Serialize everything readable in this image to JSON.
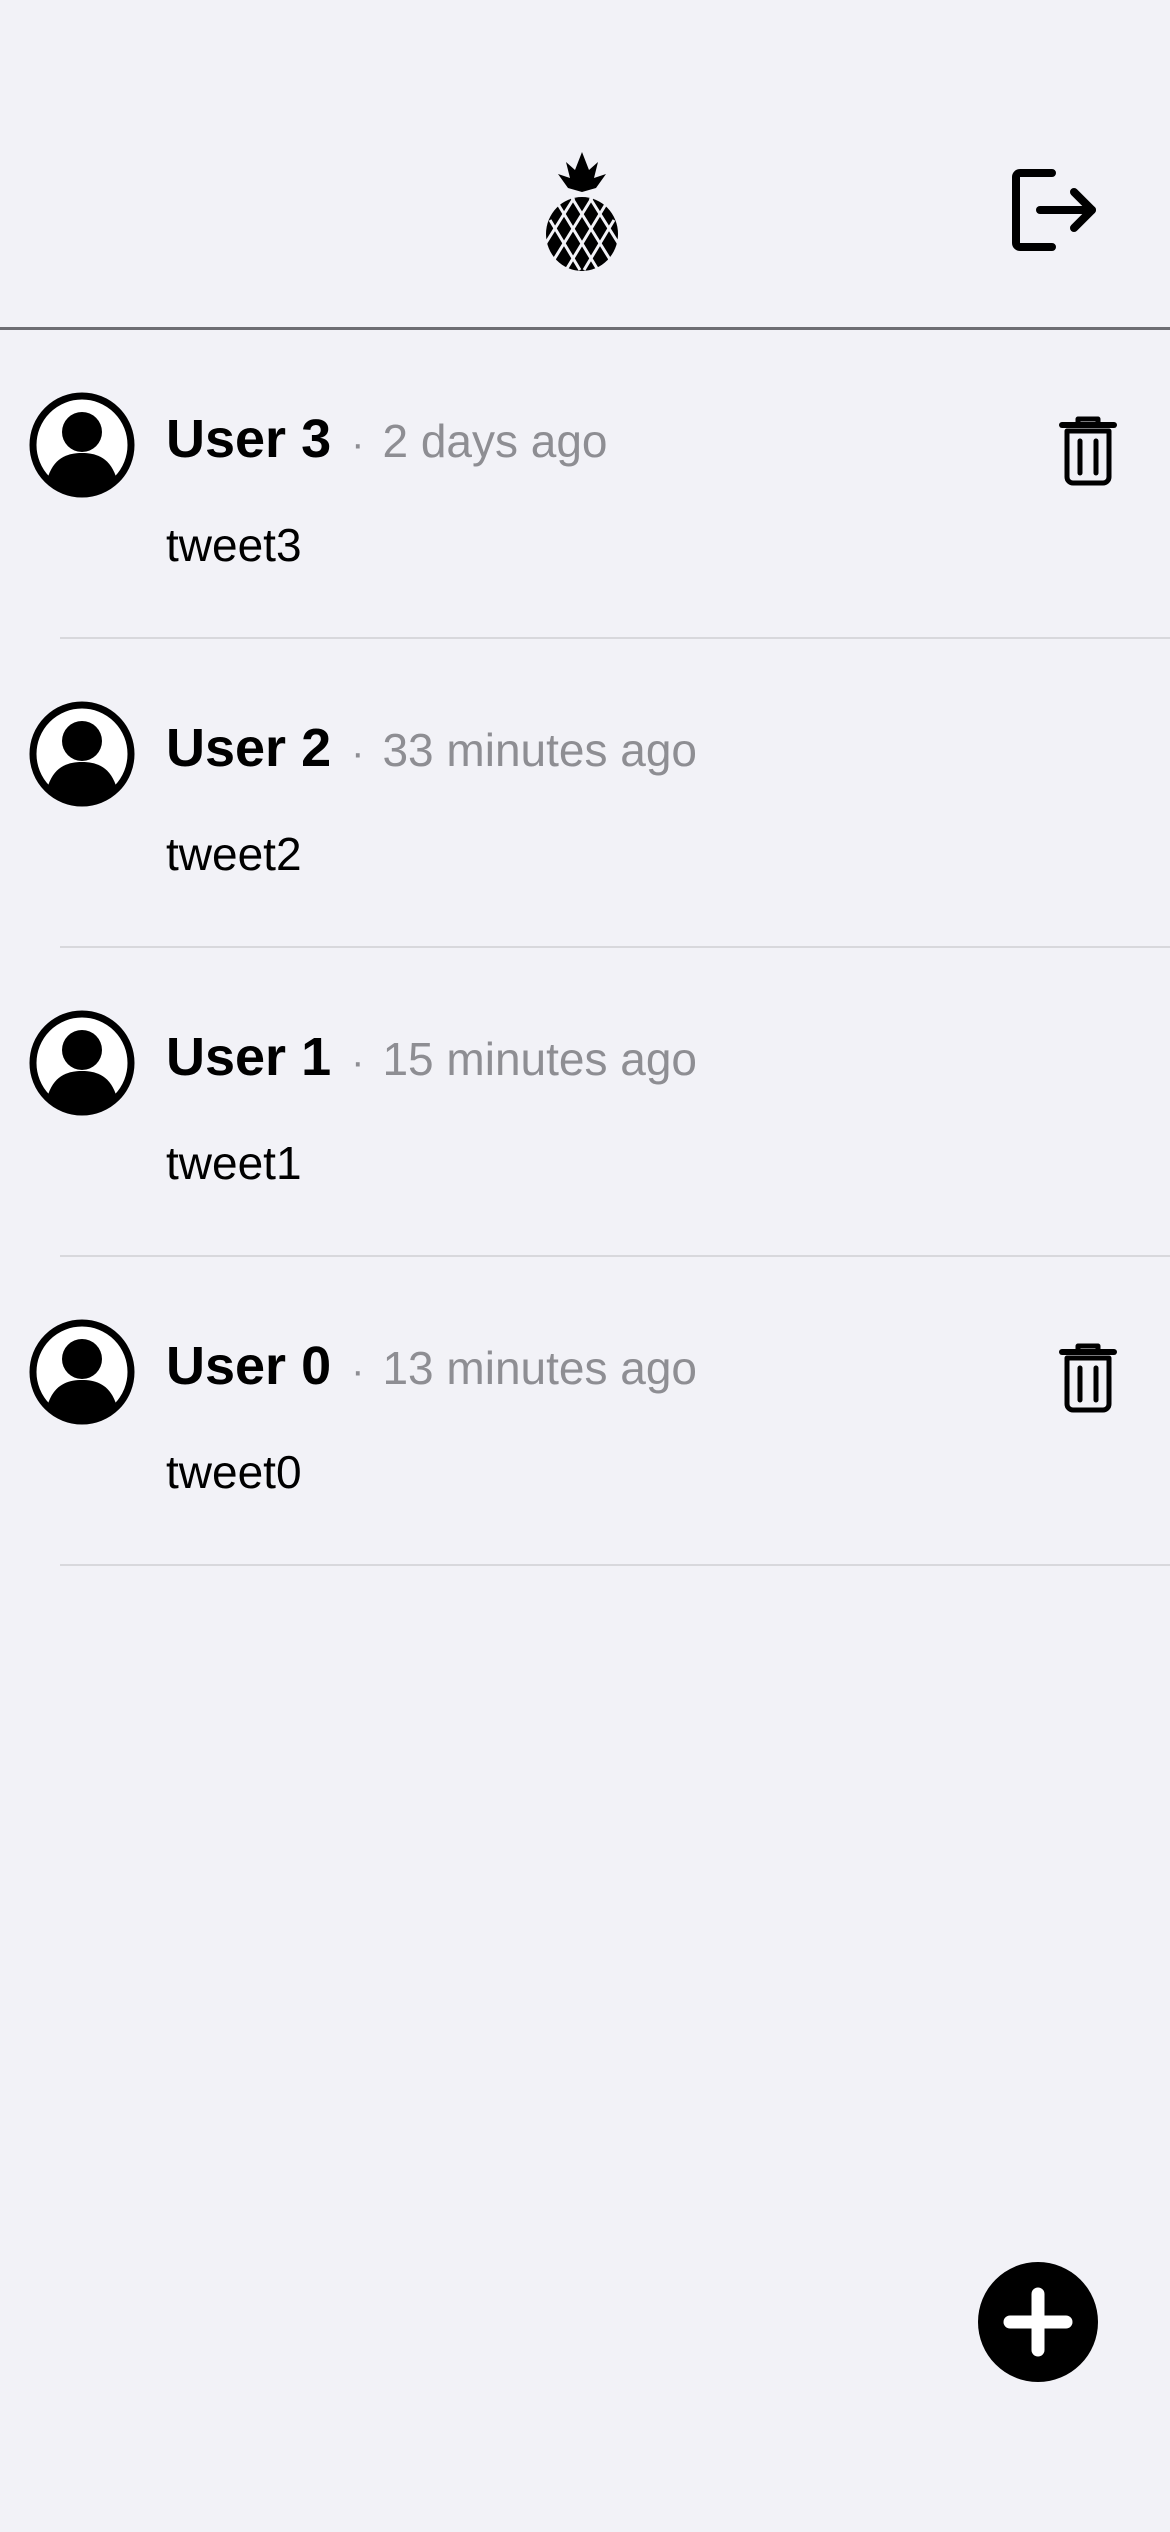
{
  "header": {
    "logo_icon": "pineapple-icon",
    "logout_icon": "logout-icon"
  },
  "feed": {
    "tweets": [
      {
        "user": "User 3",
        "separator": "·",
        "time": "2 days ago",
        "text": "tweet3",
        "can_delete": true
      },
      {
        "user": "User 2",
        "separator": "·",
        "time": "33 minutes ago",
        "text": "tweet2",
        "can_delete": false
      },
      {
        "user": "User 1",
        "separator": "·",
        "time": "15 minutes ago",
        "text": "tweet1",
        "can_delete": false
      },
      {
        "user": "User 0",
        "separator": "·",
        "time": "13 minutes ago",
        "text": "tweet0",
        "can_delete": true
      }
    ]
  },
  "fab": {
    "icon": "plus-icon"
  },
  "colors": {
    "background": "#f2f2f7",
    "secondary_text": "#8e8e93",
    "primary": "#000000"
  }
}
